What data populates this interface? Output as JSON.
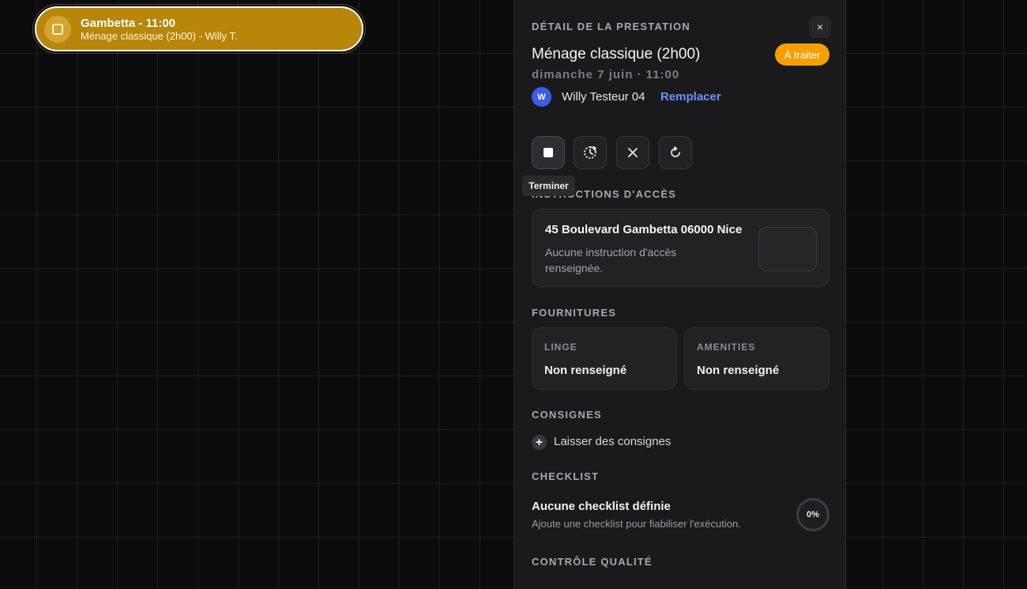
{
  "event": {
    "title": "Gambetta - 11:00",
    "subtitle": "Ménage classique (2h00) - Willy T.",
    "color": "#b7860b",
    "icon": "square-stop-icon"
  },
  "panel": {
    "header_label": "DÉTAIL DE LA PRESTATION",
    "close_label": "×",
    "title": "Ménage classique (2h00)",
    "status_badge": "À traiter",
    "status_color": "#f5a000",
    "date": "dimanche 7 juin · 11:00",
    "assignee": {
      "initial": "W",
      "name": "Willy Testeur 04",
      "replace_label": "Remplacer"
    },
    "actions": [
      {
        "name": "stop",
        "icon": "stop-icon",
        "tooltip": "Terminer"
      },
      {
        "name": "reschedule",
        "icon": "clock-rotate-icon"
      },
      {
        "name": "cancel",
        "icon": "close-icon"
      },
      {
        "name": "refresh",
        "icon": "refresh-icon"
      }
    ],
    "access": {
      "section_label": "INSTRUCTIONS D'ACCÈS",
      "address": "45 Boulevard Gambetta 06000 Nice",
      "note": "Aucune instruction d'accès renseignée."
    },
    "supplies": {
      "section_label": "FOURNITURES",
      "items": [
        {
          "label": "LINGE",
          "value": "Non renseigné"
        },
        {
          "label": "AMENITIES",
          "value": "Non renseigné"
        }
      ]
    },
    "instructions": {
      "section_label": "CONSIGNES",
      "add_label": "Laisser des consignes"
    },
    "checklist": {
      "section_label": "CHECKLIST",
      "title": "Aucune checklist définie",
      "subtitle": "Ajoute une checklist pour fiabiliser l'exécution.",
      "progress": "0%"
    },
    "quality": {
      "section_label": "CONTRÔLE QUALITÉ"
    }
  }
}
